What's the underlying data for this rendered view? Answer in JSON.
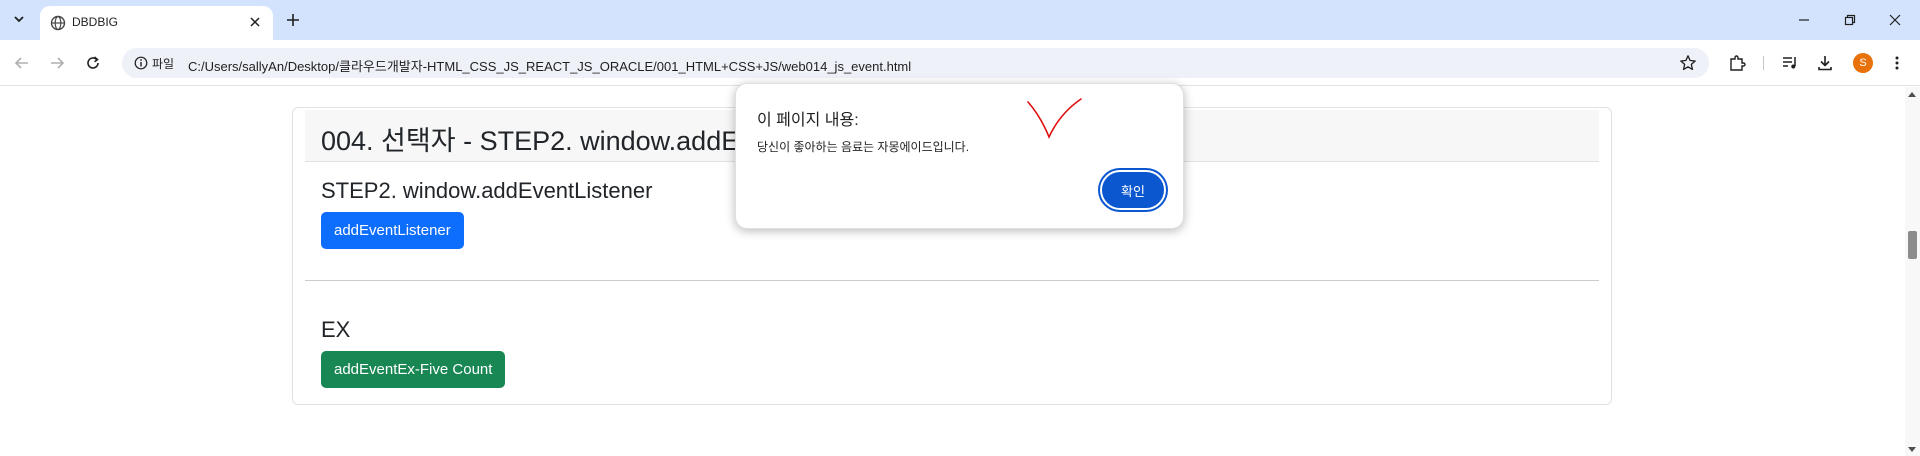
{
  "browser": {
    "tab_title": "DBDBIG",
    "site_chip_label": "파일",
    "url": "C:/Users/sallyAn/Desktop/클라우드개발자-HTML_CSS_JS_REACT_JS_ORACLE/001_HTML+CSS+JS/web014_js_event.html",
    "avatar_letter": "S"
  },
  "page": {
    "card_title": "004. 선택자 - STEP2. window.addEventListener",
    "step2_title": "STEP2. window.addEventListener",
    "step2_button": "addEventListener",
    "ex_title": "EX",
    "ex_button": "addEventEx-Five Count"
  },
  "dialog": {
    "title": "이 페이지 내용:",
    "message": "당신이 좋아하는 음료는 자몽에이드입니다.",
    "ok_label": "확인"
  },
  "colors": {
    "tabbar": "#d3e3fd",
    "primary_button": "#0d6efd",
    "success_button": "#198754",
    "dialog_ok": "#0b57d0",
    "avatar": "#e8710a",
    "annotation_mark": "#e01010"
  },
  "icons": {
    "tab_search": "chevron-down-icon",
    "favicon": "globe-icon",
    "tab_close": "close-icon",
    "new_tab": "plus-icon",
    "back": "arrow-left-icon",
    "forward": "arrow-right-icon",
    "reload": "reload-icon",
    "site_info": "info-icon",
    "bookmark": "star-icon",
    "extensions": "puzzle-icon",
    "media": "media-control-icon",
    "downloads": "download-icon",
    "menu": "more-vertical-icon"
  }
}
